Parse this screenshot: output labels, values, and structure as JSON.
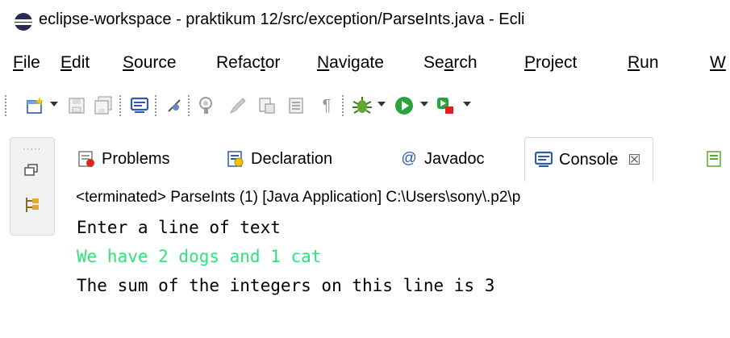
{
  "window": {
    "title": "eclipse-workspace - praktikum 12/src/exception/ParseInts.java - Ecli",
    "app_icon": "eclipse-icon"
  },
  "menu": [
    {
      "mn": "F",
      "rest": "ile"
    },
    {
      "mn": "E",
      "rest": "dit"
    },
    {
      "mn": "S",
      "rest": "ource"
    },
    {
      "pre": "Refac",
      "mn": "t",
      "rest": "or"
    },
    {
      "mn": "N",
      "rest": "avigate"
    },
    {
      "pre": "Se",
      "mn": "a",
      "rest": "rch"
    },
    {
      "mn": "P",
      "rest": "roject"
    },
    {
      "mn": "R",
      "rest": "un"
    },
    {
      "mn": "W",
      "rest": ""
    }
  ],
  "toolbar": {
    "icons": [
      "new-icon",
      "save-icon",
      "save-all-icon",
      "console-view-icon",
      "skip-breakpoints-icon",
      "toggle-breakpoint-icon",
      "edit-icon",
      "external-icon",
      "format-icon",
      "show-whitespace-icon",
      "debug-icon",
      "run-icon",
      "coverage-icon"
    ]
  },
  "tabs": [
    {
      "label": "Problems",
      "icon": "problems-icon"
    },
    {
      "label": "Declaration",
      "icon": "declaration-icon"
    },
    {
      "label": "Javadoc",
      "icon": "at-icon",
      "glyph": "@"
    },
    {
      "label": "Console",
      "icon": "console-icon",
      "close": "☒"
    }
  ],
  "console": {
    "status": "<terminated> ParseInts (1) [Java Application] C:\\Users\\sony\\.p2\\p",
    "lines": [
      "Enter a line of text",
      "We have 2 dogs and 1 cat",
      "The sum of the integers on this line is 3"
    ]
  },
  "colors": {
    "input_text": "#2ee377",
    "run_green": "#29a33b",
    "debug_green": "#5fa833",
    "console_blue": "#2e5aa8"
  }
}
